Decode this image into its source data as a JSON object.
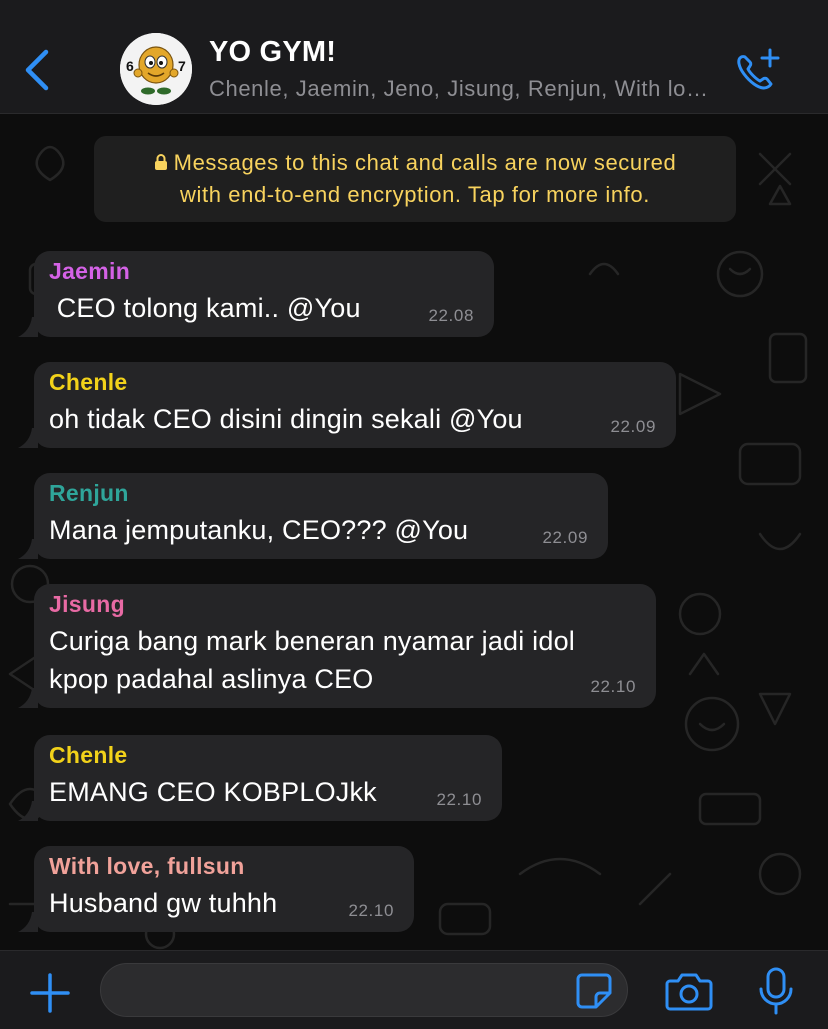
{
  "header": {
    "title": "YO GYM!",
    "members": "Chenle, Jaemin, Jeno, Jisung, Renjun, With love, fullsun, You",
    "back_icon": "chevron-left-icon",
    "call_icon": "phone-plus-icon",
    "accent_color": "#2f8ff5",
    "avatar": {
      "description_icon": "emoji-character-avatar",
      "label_left": "6",
      "label_right": "7"
    }
  },
  "encryption_notice": {
    "line1": "Messages to this chat and calls are now secured",
    "line2": "with end-to-end encryption. Tap for more info.",
    "icon": "lock-icon",
    "color": "#f8d35e"
  },
  "messages": [
    {
      "sender": "Jaemin",
      "color": "#d462e6",
      "text": " CEO tolong kami.. @You",
      "time": "22.08"
    },
    {
      "sender": "Chenle",
      "color": "#f2d21a",
      "text": "oh tidak CEO disini dingin sekali @You",
      "time": "22.09"
    },
    {
      "sender": "Renjun",
      "color": "#2fa59a",
      "text": "Mana jemputanku, CEO??? @You",
      "time": "22.09"
    },
    {
      "sender": "Jisung",
      "color": "#e86aa4",
      "text": "Curiga bang mark beneran nyamar jadi idol\nkpop padahal aslinya CEO",
      "time": "22.10"
    },
    {
      "sender": "Chenle",
      "color": "#f2d21a",
      "text": "EMANG CEO KOBPLOJkk",
      "time": "22.10"
    },
    {
      "sender": "With love, fullsun",
      "color": "#f1a29a",
      "text": "Husband gw tuhhh",
      "time": "22.10"
    }
  ],
  "input_bar": {
    "placeholder": "",
    "value": "",
    "plus_icon": "plus-icon",
    "sticker_icon": "sticker-icon",
    "camera_icon": "camera-icon",
    "mic_icon": "microphone-icon"
  }
}
